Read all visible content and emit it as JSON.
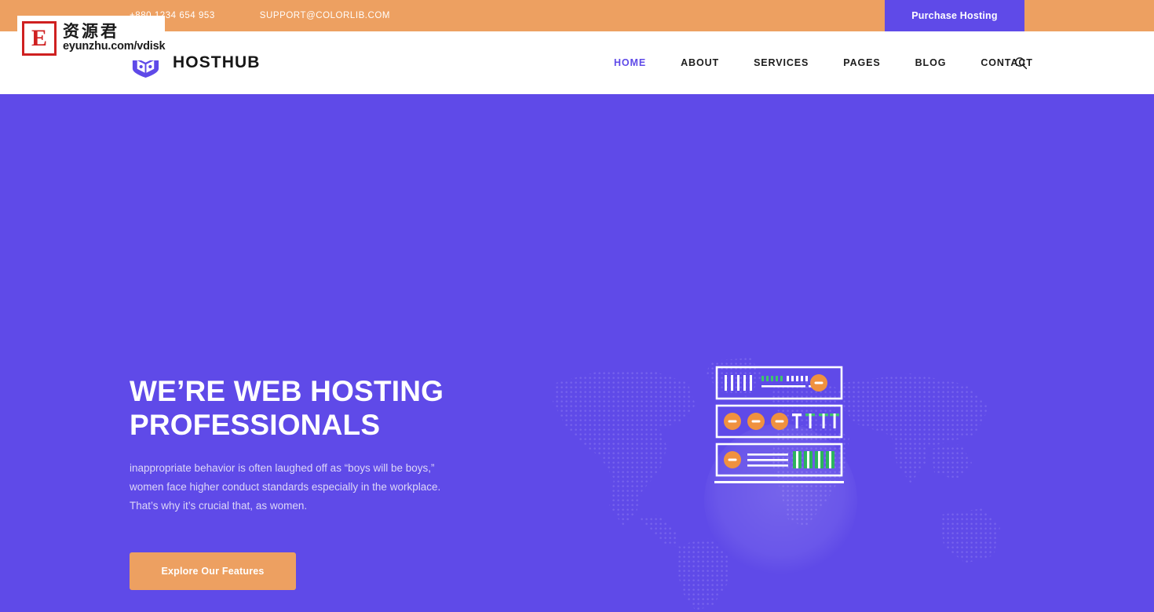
{
  "topbar": {
    "phone": "+880 1234 654 953",
    "email": "SUPPORT@COLORLIB.COM",
    "purchase_label": "Purchase Hosting",
    "bg_color": "#eda061",
    "purchase_bg_color": "#5f4ae8"
  },
  "header": {
    "brand_name": "HOSTHUB",
    "logo_icon": "cube-box-icon",
    "logo_color": "#5f4ae8",
    "search_icon": "search-icon",
    "nav": [
      {
        "label": "HOME",
        "active": true
      },
      {
        "label": "ABOUT",
        "active": false
      },
      {
        "label": "SERVICES",
        "active": false
      },
      {
        "label": "PAGES",
        "active": false
      },
      {
        "label": "BLOG",
        "active": false
      },
      {
        "label": "CONTACT",
        "active": false
      }
    ]
  },
  "hero": {
    "title": "WE’RE WEB HOSTING PROFESSIONALS",
    "paragraph": "inappropriate behavior is often laughed off as “boys will be boys,” women face higher conduct standards especially in the workplace. That’s why it’s crucial that, as women.",
    "cta_label": "Explore Our Features",
    "bg_color": "#5f4ae8",
    "cta_color": "#eda061",
    "illustration": "server-rack-illustration",
    "background_graphic": "dotted-world-map"
  },
  "watermark": {
    "badge_letter": "E",
    "chinese_text": "资源君",
    "url": "eyunzhu.com/vdisk",
    "badge_color": "#cf2020"
  }
}
